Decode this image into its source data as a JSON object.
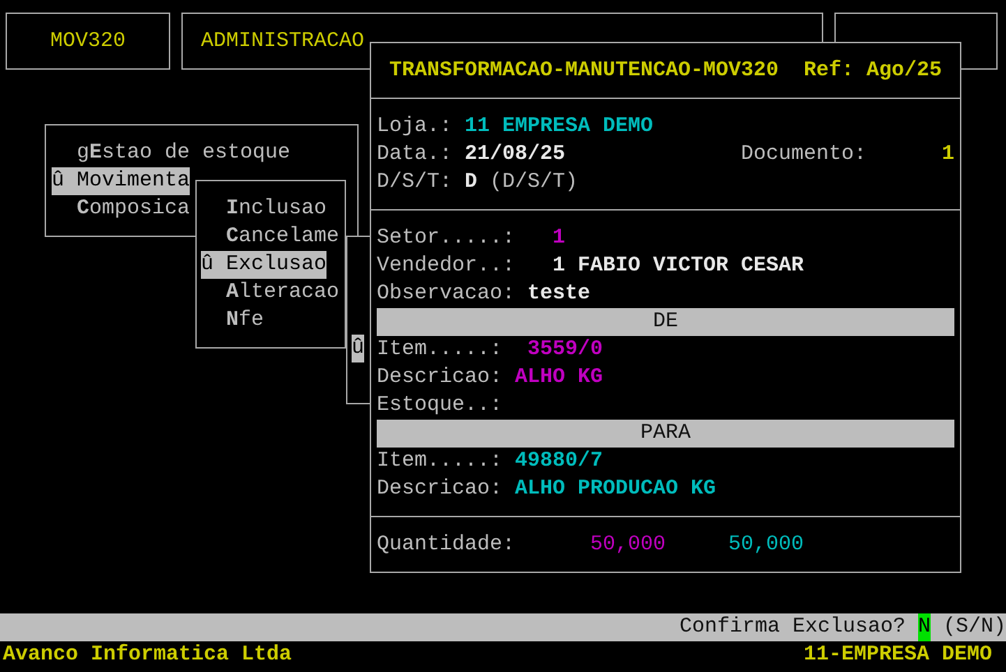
{
  "top_frames": [
    {
      "label": "MOV320"
    },
    {
      "label": "ADMINISTRACAO"
    }
  ],
  "menu": {
    "items": [
      {
        "text": "g**E**stao de estoque",
        "selected": false
      },
      {
        "text": "û Movimenta",
        "selected": true
      },
      {
        "text": "**C**omposica",
        "selected": false
      }
    ]
  },
  "submenu": {
    "items": [
      {
        "text": "**I**nclusao",
        "selected": false
      },
      {
        "text": "**C**ancelame",
        "selected": false
      },
      {
        "text": "û Exclusao",
        "selected": true
      },
      {
        "text": "**A**lteracao",
        "selected": false
      },
      {
        "text": "**N**fe",
        "selected": false
      }
    ]
  },
  "behind_window": {
    "marker": "û"
  },
  "form": {
    "title": "TRANSFORMACAO-MANUTENCAO-MOV320",
    "ref": "Ref: Ago/25",
    "loja": {
      "label": "Loja.:",
      "value": "11 EMPRESA DEMO"
    },
    "data": {
      "label": "Data.:",
      "value": "21/08/25"
    },
    "documento": {
      "label": "Documento:",
      "value": "1"
    },
    "dst": {
      "label": "D/S/T:",
      "value": "D",
      "hint": "(D/S/T)"
    },
    "details": [
      {
        "label": "Setor.....:",
        "value": "1",
        "color": "#c000c0"
      },
      {
        "label": "Vendedor..:",
        "value": "1 FABIO VICTOR CESAR",
        "color": "#e8e8e8"
      },
      {
        "label": "Observacao:",
        "value": "teste",
        "color": "#e8e8e8"
      }
    ],
    "sections": [
      {
        "heading": "DE",
        "color": "#c000c0",
        "fields": [
          {
            "label": "Item.....:",
            "value": "3559/0"
          },
          {
            "label": "Descricao:",
            "value": "ALHO KG"
          },
          {
            "label": "Estoque..:"
          }
        ]
      },
      {
        "heading": "PARA",
        "color": "#00bcbc",
        "fields": [
          {
            "label": "Item.....:",
            "value": "49880/7"
          },
          {
            "label": "Descricao:",
            "value": "ALHO PRODUCAO KG"
          }
        ]
      }
    ],
    "quantity": {
      "label": "Quantidade:",
      "values": [
        {
          "text": "50,000",
          "color": "#c000c0"
        },
        {
          "text": "50,000",
          "color": "#00bcbc"
        }
      ]
    }
  },
  "prompt": {
    "question": "Confirma Exclusao?",
    "answer": "N",
    "options": "(S/N)"
  },
  "footer": {
    "company": "Avanco Informatica Ltda",
    "store": "11-EMPRESA DEMO"
  }
}
